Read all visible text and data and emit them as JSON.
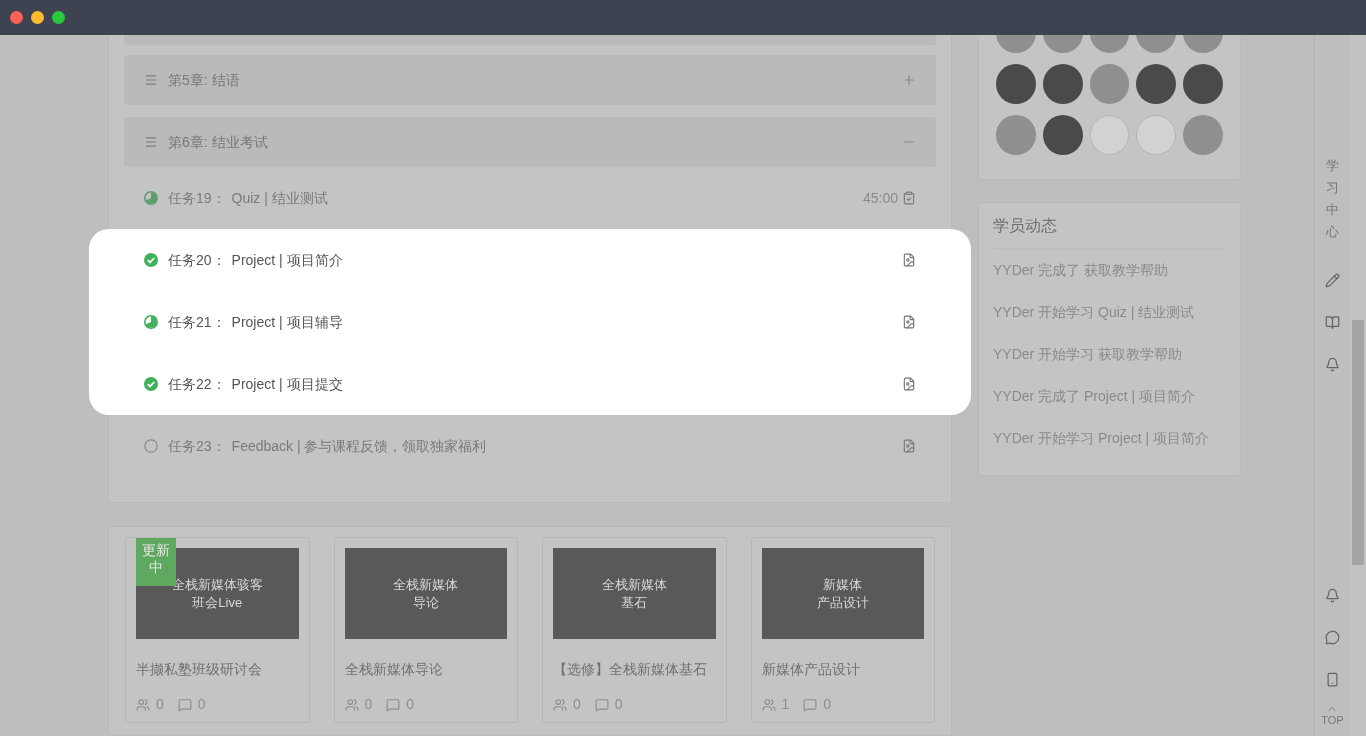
{
  "chapters": [
    {
      "title": "第5章: 结语",
      "expanded": false
    },
    {
      "title": "第6章: 结业考试",
      "expanded": true
    }
  ],
  "tasks": [
    {
      "number": "任务19：",
      "title": "Quiz | 结业测试",
      "started": true,
      "done": false,
      "duration": "45:00",
      "kind": "quiz",
      "highlighted": false
    },
    {
      "number": "任务20：",
      "title": "Project | 项目简介",
      "started": true,
      "done": true,
      "kind": "doc",
      "highlighted": true
    },
    {
      "number": "任务21：",
      "title": "Project | 项目辅导",
      "started": true,
      "done": false,
      "kind": "doc",
      "highlighted": true
    },
    {
      "number": "任务22：",
      "title": "Project | 项目提交",
      "started": true,
      "done": true,
      "kind": "doc",
      "highlighted": true
    },
    {
      "number": "任务23：",
      "title": "Feedback | 参与课程反馈，领取独家福利",
      "started": false,
      "done": false,
      "kind": "doc",
      "highlighted": false
    }
  ],
  "courses": [
    {
      "badge": "更新中",
      "cover_lines": [
        "全栈新媒体骇客",
        "班会Live"
      ],
      "title": "半撷私塾班级研讨会",
      "members": "0",
      "comments": "0"
    },
    {
      "cover_lines": [
        "全栈新媒体",
        "导论"
      ],
      "title": "全栈新媒体导论",
      "members": "0",
      "comments": "0"
    },
    {
      "cover_lines": [
        "全栈新媒体",
        "基石"
      ],
      "title": "【选修】全栈新媒体基石",
      "members": "0",
      "comments": "0"
    },
    {
      "cover_lines": [
        "新媒体",
        "产品设计"
      ],
      "title": "新媒体产品设计",
      "members": "1",
      "comments": "0"
    }
  ],
  "activity": {
    "title": "学员动态",
    "items": [
      "YYDer 完成了 获取教学帮助",
      "YYDer 开始学习 Quiz | 结业测试",
      "YYDer 开始学习 获取教学帮助",
      "YYDer 完成了 Project | 项目简介",
      "YYDer 开始学习 Project | 项目简介"
    ]
  },
  "side_toolbar": {
    "label": "学习中心",
    "top": "TOP"
  }
}
